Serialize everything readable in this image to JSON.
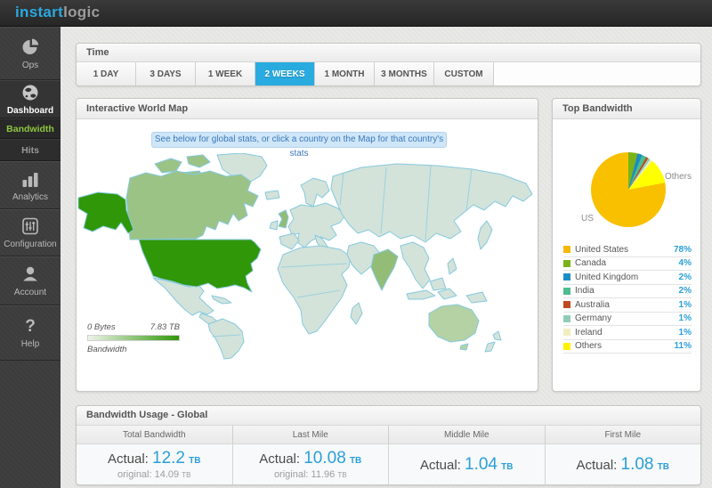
{
  "header": {
    "logo_primary": "instart",
    "logo_secondary": "logic"
  },
  "colors": {
    "accent_blue": "#2b9fd9",
    "sidebar_active_green": "#8dc63f",
    "selected_button_blue": "#29abdf"
  },
  "sidebar": {
    "ops_label": "Ops",
    "dashboard_label": "Dashboard",
    "bandwidth_label": "Bandwidth",
    "hits_label": "Hits",
    "analytics_label": "Analytics",
    "configuration_label": "Configuration",
    "account_label": "Account",
    "help_label": "Help",
    "help_glyph": "?"
  },
  "time_panel": {
    "title": "Time",
    "buttons": [
      "1 DAY",
      "3 DAYS",
      "1 WEEK",
      "2 WEEKS",
      "1 MONTH",
      "3 MONTHS",
      "CUSTOM"
    ],
    "selected": "2 WEEKS"
  },
  "map_panel": {
    "title": "Interactive World Map",
    "info_text": "See below for global stats, or click a country on the Map for that country's stats",
    "legend": {
      "min": "0 Bytes",
      "max": "7.83 TB",
      "label": "Bandwidth",
      "gradient_start": "#eef3ea",
      "gradient_end": "#2f9708"
    },
    "colors": {
      "highest": "#2f9708",
      "high": "#9cc386",
      "medium": "#93bd77",
      "low": "#b4d2a4",
      "base": "#d3e3da",
      "border": "#85c9de"
    }
  },
  "top_bandwidth": {
    "title": "Top Bandwidth",
    "pie_annotation_us": "US",
    "pie_annotation_others": "Others",
    "legend_rows": [
      {
        "label": "United States",
        "value": "78%",
        "color": "#f5b800"
      },
      {
        "label": "Canada",
        "value": "4%",
        "color": "#7ab317"
      },
      {
        "label": "United Kingdom",
        "value": "2%",
        "color": "#1b8dc6"
      },
      {
        "label": "India",
        "value": "2%",
        "color": "#4dbd8e"
      },
      {
        "label": "Australia",
        "value": "1%",
        "color": "#bf4a1f"
      },
      {
        "label": "Germany",
        "value": "1%",
        "color": "#8fcdb9"
      },
      {
        "label": "Ireland",
        "value": "1%",
        "color": "#f2eec0"
      },
      {
        "label": "Others",
        "value": "11%",
        "color": "#fff200"
      }
    ]
  },
  "chart_data": {
    "type": "pie",
    "title": "Top Bandwidth",
    "labels": [
      "United States",
      "Canada",
      "United Kingdom",
      "India",
      "Australia",
      "Germany",
      "Ireland",
      "Others"
    ],
    "values": [
      78,
      4,
      2,
      2,
      1,
      1,
      1,
      11
    ],
    "unit": "percent of bandwidth",
    "colors": [
      "#f9c000",
      "#7ab317",
      "#1b8dc6",
      "#4dbd8e",
      "#bf4a1f",
      "#8fcdb9",
      "#f2eec0",
      "#ffff00"
    ],
    "annotations": [
      "US",
      "Others"
    ],
    "legend_position": "bottom"
  },
  "usage_panel": {
    "title": "Bandwidth Usage - Global",
    "columns": [
      {
        "header": "Total Bandwidth",
        "actual_label": "Actual:",
        "actual_value": "12.2",
        "actual_unit": "TB",
        "original_label": "original:",
        "original_value": "14.09",
        "original_unit": "TB"
      },
      {
        "header": "Last Mile",
        "actual_label": "Actual:",
        "actual_value": "10.08",
        "actual_unit": "TB",
        "original_label": "original:",
        "original_value": "11.96",
        "original_unit": "TB"
      },
      {
        "header": "Middle Mile",
        "actual_label": "Actual:",
        "actual_value": "1.04",
        "actual_unit": "TB"
      },
      {
        "header": "First Mile",
        "actual_label": "Actual:",
        "actual_value": "1.08",
        "actual_unit": "TB"
      }
    ]
  }
}
